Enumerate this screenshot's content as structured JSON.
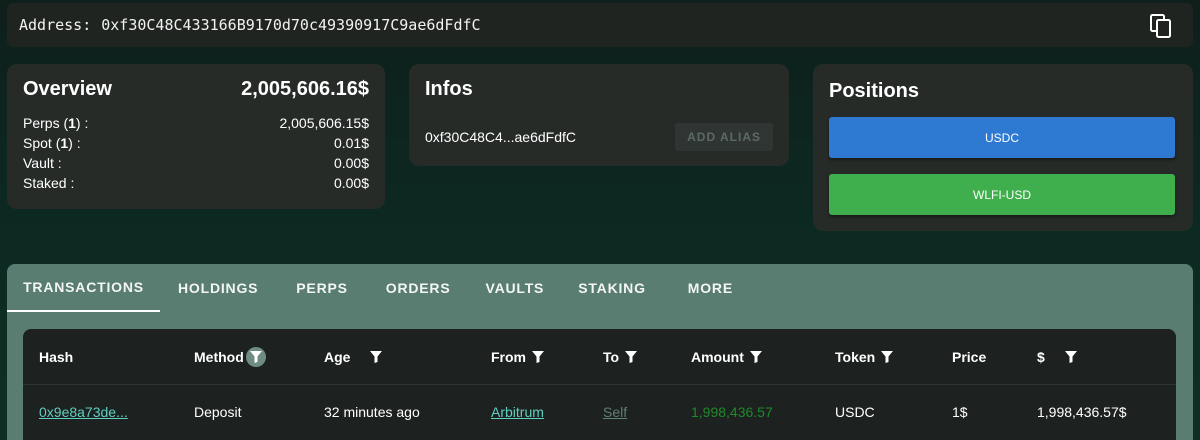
{
  "address": {
    "label": "Address:",
    "value": "0xf30C48C433166B9170d70c49390917C9ae6dFdfC"
  },
  "overview": {
    "title": "Overview",
    "total": "2,005,606.16$",
    "rows": [
      {
        "label_pre": "Perps (",
        "count": "1",
        "label_post": ") :",
        "value": "2,005,606.15$"
      },
      {
        "label_pre": "Spot (",
        "count": "1",
        "label_post": ") :",
        "value": "0.01$"
      },
      {
        "label_pre": "Vault :",
        "count": "",
        "label_post": "",
        "value": "0.00$"
      },
      {
        "label_pre": "Staked :",
        "count": "",
        "label_post": "",
        "value": "0.00$"
      }
    ]
  },
  "infos": {
    "title": "Infos",
    "short_address": "0xf30C48C4...ae6dFdfC",
    "add_alias_label": "ADD ALIAS"
  },
  "positions": {
    "title": "Positions",
    "items": [
      {
        "label": "USDC",
        "color": "#2e79d2"
      },
      {
        "label": "WLFI-USD",
        "color": "#3fae4c"
      }
    ]
  },
  "tabs": [
    {
      "label": "TRANSACTIONS",
      "active": true
    },
    {
      "label": "HOLDINGS",
      "active": false
    },
    {
      "label": "PERPS",
      "active": false
    },
    {
      "label": "ORDERS",
      "active": false
    },
    {
      "label": "VAULTS",
      "active": false
    },
    {
      "label": "STAKING",
      "active": false
    },
    {
      "label": "MORE",
      "active": false
    }
  ],
  "table": {
    "columns": [
      {
        "label": "Hash",
        "filter": false
      },
      {
        "label": "Method",
        "filter": true,
        "filter_highlight": true
      },
      {
        "label": "Age",
        "filter": true
      },
      {
        "label": "From",
        "filter": true
      },
      {
        "label": "To",
        "filter": true
      },
      {
        "label": "Amount",
        "filter": true
      },
      {
        "label": "Token",
        "filter": true
      },
      {
        "label": "Price",
        "filter": false
      },
      {
        "label": "$",
        "filter": true
      }
    ],
    "rows": [
      {
        "hash": "0x9e8a73de...",
        "method": "Deposit",
        "age": "32 minutes ago",
        "from": "Arbitrum",
        "to": "Self",
        "amount": "1,998,436.57",
        "token": "USDC",
        "price": "1$",
        "usd": "1,998,436.57$"
      }
    ]
  },
  "colors": {
    "background": "#0d2a22",
    "card": "#262b28",
    "tab_bar": "#5a7d72",
    "link": "#5fd0c0",
    "amount_green": "#1f8a2a"
  },
  "icons": {
    "copy": "copy-icon",
    "filter": "filter-icon"
  }
}
